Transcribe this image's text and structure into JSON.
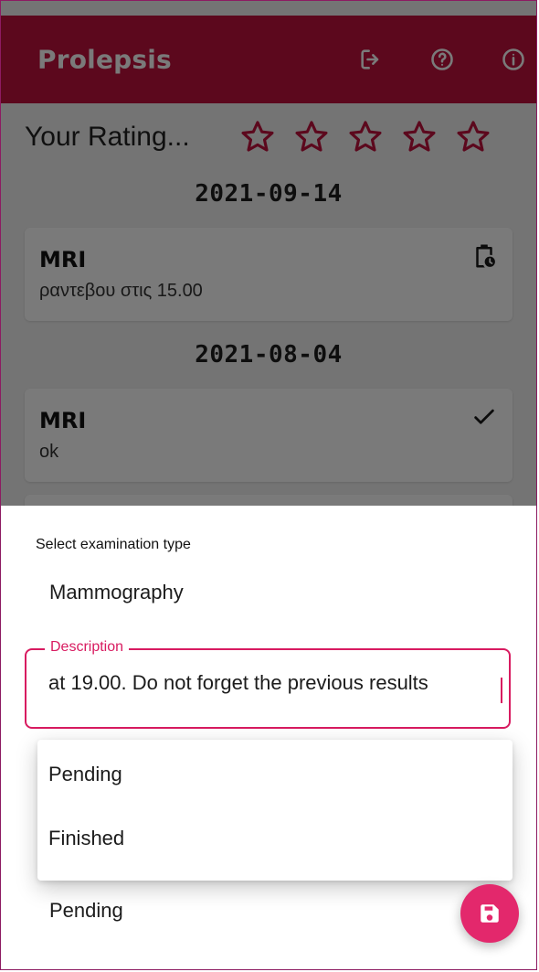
{
  "app": {
    "title": "Prolepsis",
    "brand_color": "#c0113e",
    "accent_color": "#d81b60",
    "toolbar_icons": [
      "logout-icon",
      "help-icon",
      "info-icon"
    ]
  },
  "rating": {
    "label": "Your Rating...",
    "max_stars": 5,
    "selected_stars": 0,
    "star_icon": "star-outline-icon"
  },
  "timeline": [
    {
      "date": "2021-09-14",
      "items": [
        {
          "title": "MRI",
          "note": "ραντεβου στις 15.00",
          "status_icon": "clipboard-clock-icon"
        }
      ]
    },
    {
      "date": "2021-08-04",
      "items": [
        {
          "title": "MRI",
          "note": "ok",
          "status_icon": "check-icon"
        }
      ]
    }
  ],
  "sheet": {
    "exam_type_label": "Select examination type",
    "exam_type_value": "Mammography",
    "description_label": "Description",
    "description_value": "at 19.00. Do not forget the previous results",
    "status_value": "Pending",
    "status_options": [
      "Pending",
      "Finished"
    ],
    "save_icon": "save-icon"
  }
}
